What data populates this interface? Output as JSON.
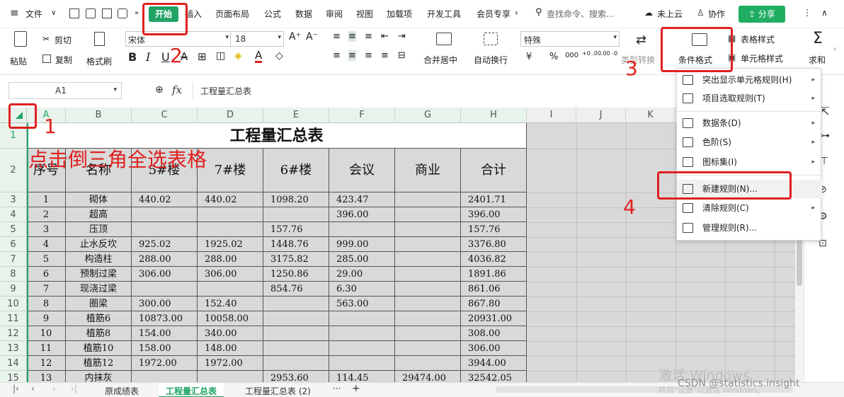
{
  "menubar": {
    "file": "文件",
    "tabs": [
      "开始",
      "插入",
      "页面布局",
      "公式",
      "数据",
      "审阅",
      "视图",
      "加载项",
      "开发工具",
      "会员专享"
    ],
    "more_arrow": "›",
    "search_placeholder": "查找命令、搜索...",
    "cloud": "未上云",
    "collab": "协作",
    "share": "分享"
  },
  "ribbon": {
    "paste": "粘贴",
    "cut": "剪切",
    "copy": "复制",
    "format_painter": "格式刷",
    "font_name": "宋体",
    "font_size": "18",
    "merge_center": "合并居中",
    "wrap_text": "自动换行",
    "number_format": "特殊",
    "type_convert": "类型转换",
    "conditional_format": "条件格式",
    "table_style": "表格样式",
    "cell_style": "单元格样式",
    "sum": "求和",
    "currency_symbol": "¥",
    "percent_symbol": "%",
    "thousands": "000",
    "inc_decimal": "+0 .00",
    "dec_decimal": ".00 -0"
  },
  "formula_bar": {
    "name_box": "A1",
    "fx": "fx",
    "content": "工程量汇总表"
  },
  "grid": {
    "columns": [
      "A",
      "B",
      "C",
      "D",
      "E",
      "F",
      "G",
      "H",
      "I",
      "J",
      "K"
    ],
    "rows": [
      "1",
      "2",
      "3",
      "4",
      "5",
      "6",
      "7",
      "8",
      "9",
      "10",
      "11",
      "12",
      "13",
      "14",
      "15"
    ],
    "title": "工程量汇总表",
    "headers": [
      "序号",
      "名称",
      "5#楼",
      "7#楼",
      "6#楼",
      "会议",
      "商业",
      "合计"
    ],
    "data": [
      [
        "1",
        "砌体",
        "440.02",
        "440.02",
        "1098.20",
        "423.47",
        "",
        "2401.71"
      ],
      [
        "2",
        "超高",
        "",
        "",
        "",
        "396.00",
        "",
        "396.00"
      ],
      [
        "3",
        "压顶",
        "",
        "",
        "157.76",
        "",
        "",
        "157.76"
      ],
      [
        "4",
        "止水反坎",
        "925.02",
        "1925.02",
        "1448.76",
        "999.00",
        "",
        "3376.80"
      ],
      [
        "5",
        "构造柱",
        "288.00",
        "288.00",
        "3175.82",
        "285.00",
        "",
        "4036.82"
      ],
      [
        "6",
        "预制过梁",
        "306.00",
        "306.00",
        "1250.86",
        "29.00",
        "",
        "1891.86"
      ],
      [
        "7",
        "现浇过梁",
        "",
        "",
        "854.76",
        "6.30",
        "",
        "861.06"
      ],
      [
        "8",
        "圈梁",
        "300.00",
        "152.40",
        "",
        "563.00",
        "",
        "867.80"
      ],
      [
        "9",
        "植筋6",
        "10873.00",
        "10058.00",
        "",
        "",
        "",
        "20931.00"
      ],
      [
        "10",
        "植筋8",
        "154.00",
        "340.00",
        "",
        "",
        "",
        "308.00"
      ],
      [
        "11",
        "植筋10",
        "158.00",
        "148.00",
        "",
        "",
        "",
        "306.00"
      ],
      [
        "12",
        "植筋12",
        "1972.00",
        "1972.00",
        "",
        "",
        "",
        "3944.00"
      ],
      [
        "13",
        "内抹灰",
        "",
        "",
        "2953.60",
        "114.45",
        "29474.00",
        "32542.05"
      ]
    ]
  },
  "dropdown": {
    "items": [
      {
        "label": "突出显示单元格规则(H)",
        "arrow": true
      },
      {
        "label": "项目选取规则(T)",
        "arrow": true
      },
      {
        "label": "数据条(D)",
        "arrow": true
      },
      {
        "label": "色阶(S)",
        "arrow": true
      },
      {
        "label": "图标集(I)",
        "arrow": true
      },
      {
        "label": "新建规则(N)...",
        "arrow": false
      },
      {
        "label": "清除规则(C)",
        "arrow": true
      },
      {
        "label": "管理规则(R)...",
        "arrow": false
      }
    ]
  },
  "sheets": {
    "tabs": [
      "原成绩表",
      "工程量汇总表",
      "工程量汇总表 (2)"
    ],
    "more": "···",
    "add": "+"
  },
  "annotations": {
    "n1": "1",
    "n2": "2",
    "n3": "3",
    "n4": "4",
    "instruction": "点击倒三角全选表格"
  },
  "watermark": {
    "activate_title": "激活 Windows",
    "activate_sub": "转到\"设置\"以激活 Windows。",
    "csdn": "CSDN @statistics.insight"
  },
  "colors": {
    "accent": "#21a366",
    "annotation": "#e02020"
  }
}
